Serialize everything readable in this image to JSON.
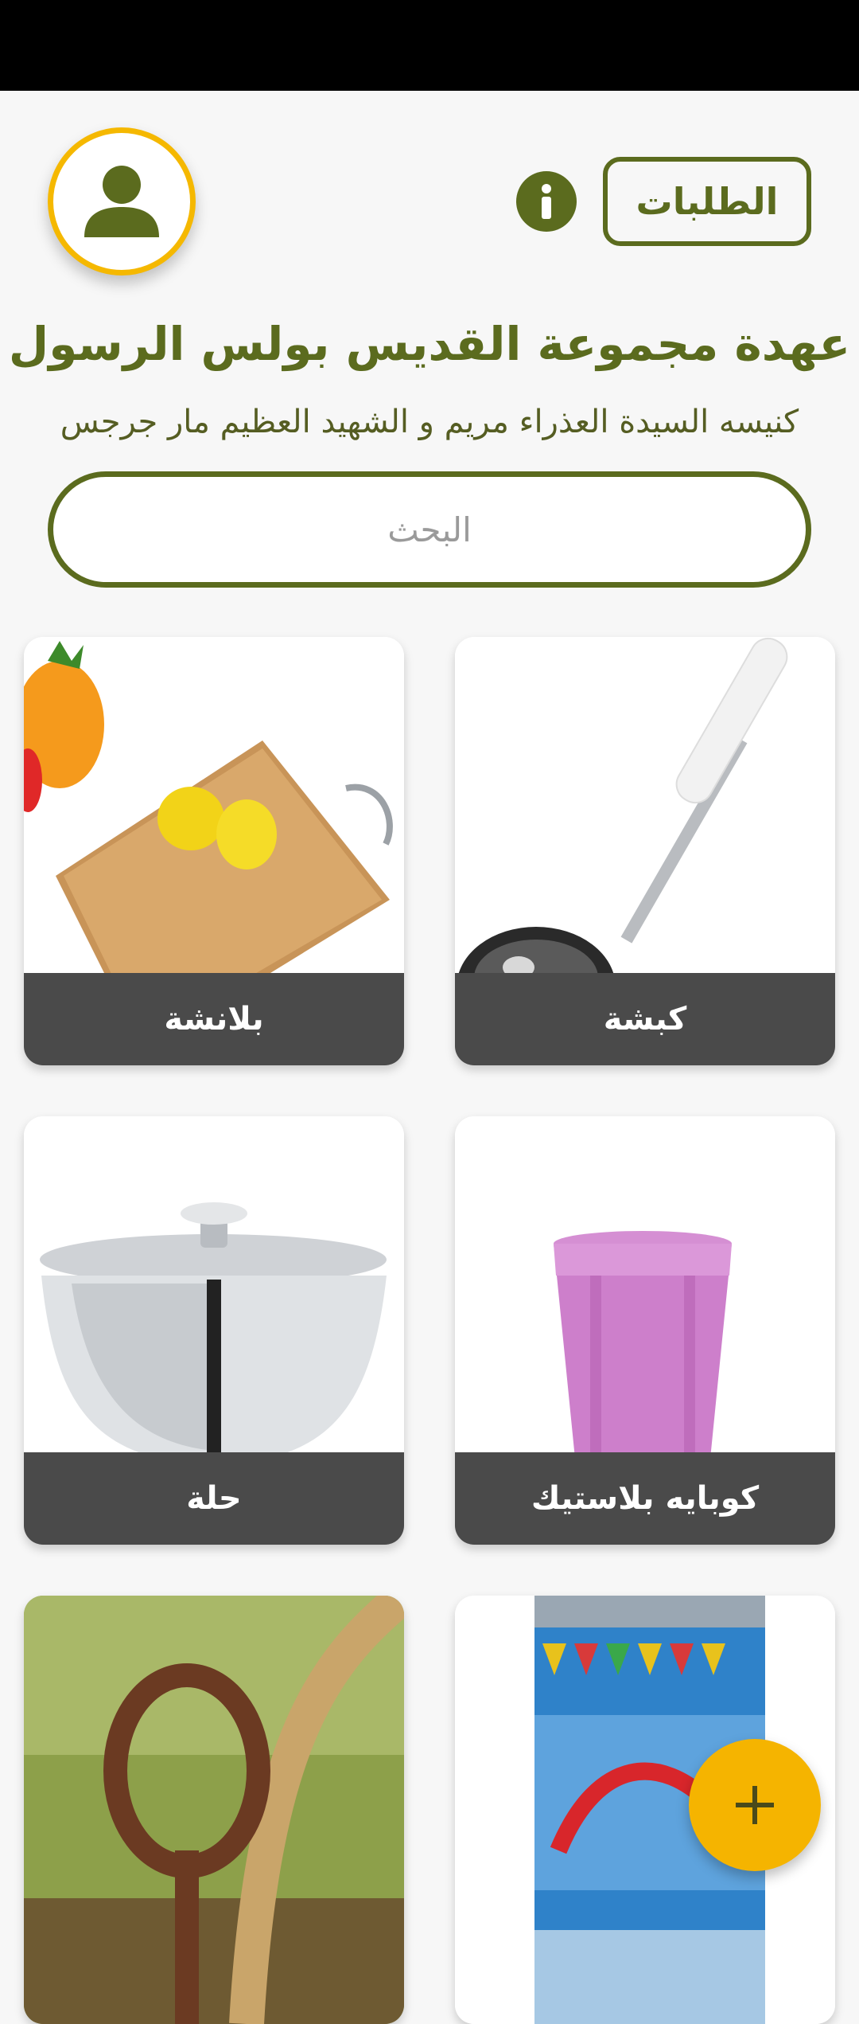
{
  "header": {
    "orders_label": "الطلبات",
    "title": "عهدة مجموعة القديس بولس الرسول",
    "subtitle": "كنيسه السيدة العذراء مريم و الشهيد العظيم مار جرجس"
  },
  "search": {
    "placeholder": "البحث"
  },
  "items": [
    {
      "label": "كبشة",
      "icon": "ladle"
    },
    {
      "label": "بلانشة",
      "icon": "cutting-board"
    },
    {
      "label": "كوبايه بلاستيك",
      "icon": "plastic-cup"
    },
    {
      "label": "حلة",
      "icon": "cooking-pot"
    },
    {
      "label": "",
      "icon": "milk-tin"
    },
    {
      "label": "",
      "icon": "rope-stake"
    }
  ],
  "colors": {
    "primary": "#5b6b1e",
    "accent": "#f5b400",
    "label_bg": "#4a4a4a"
  },
  "fab": {
    "icon": "plus-icon"
  }
}
